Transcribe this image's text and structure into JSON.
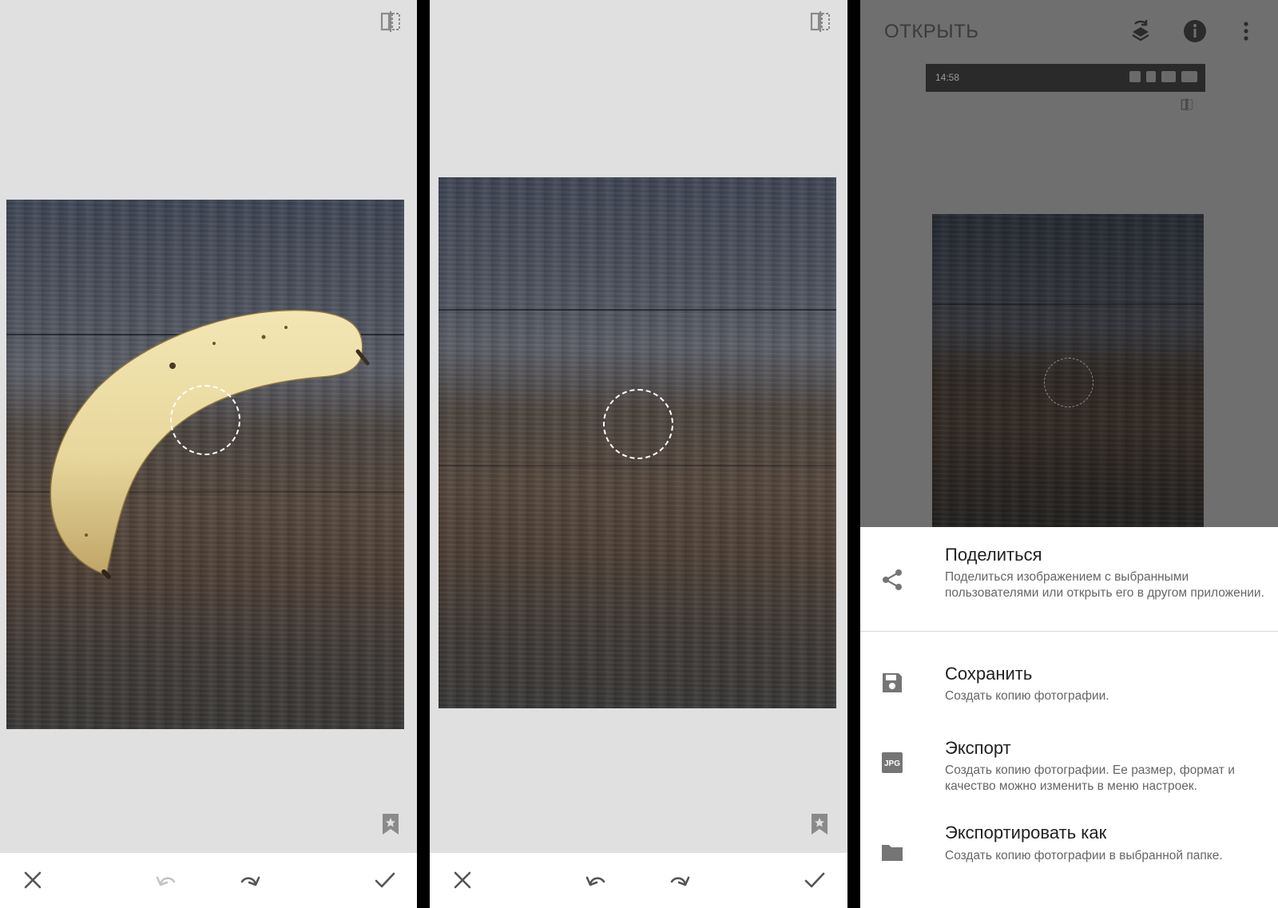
{
  "colors": {
    "panel_background": "#e0e0e0",
    "overlay_background": "#6f6f6f",
    "sheet_background": "#ffffff",
    "icon_gray": "#8a8a8a",
    "heal_circle": "#ffffff"
  },
  "panel_1": {
    "top_icon": "compare-icon",
    "bottom_bar": {
      "cancel_icon": "close-icon",
      "undo_icon": "undo-icon",
      "redo_icon": "redo-icon",
      "apply_icon": "check-icon",
      "undo_enabled": false,
      "redo_enabled": true
    },
    "photo_subject": "banana on wooden table",
    "bookmark_icon": "bookmark-star-icon"
  },
  "panel_2": {
    "top_icon": "compare-icon",
    "bottom_bar": {
      "cancel_icon": "close-icon",
      "undo_icon": "undo-icon",
      "redo_icon": "redo-icon",
      "apply_icon": "check-icon",
      "undo_enabled": true,
      "redo_enabled": true
    },
    "photo_subject": "wooden table after healing",
    "bookmark_icon": "bookmark-star-icon"
  },
  "panel_3": {
    "header": {
      "open_label": "ОТКРЫТЬ",
      "icons": [
        "layers-refresh-icon",
        "info-icon",
        "more-vert-icon"
      ]
    },
    "status_bar": {
      "time": "14:58"
    },
    "sheet": {
      "items": [
        {
          "icon": "share-icon",
          "title": "Поделиться",
          "description": "Поделиться изображением с выбранными пользователями или открыть его в другом приложении."
        },
        {
          "icon": "save-icon",
          "title": "Сохранить",
          "description": "Создать копию фотографии."
        },
        {
          "icon": "jpg-icon",
          "icon_text": "JPG",
          "title": "Экспорт",
          "description": "Создать копию фотографии. Ее размер, формат и качество можно изменить в меню настроек."
        },
        {
          "icon": "folder-icon",
          "title": "Экспортировать как",
          "description": "Создать копию фотографии в выбранной папке."
        }
      ]
    }
  }
}
